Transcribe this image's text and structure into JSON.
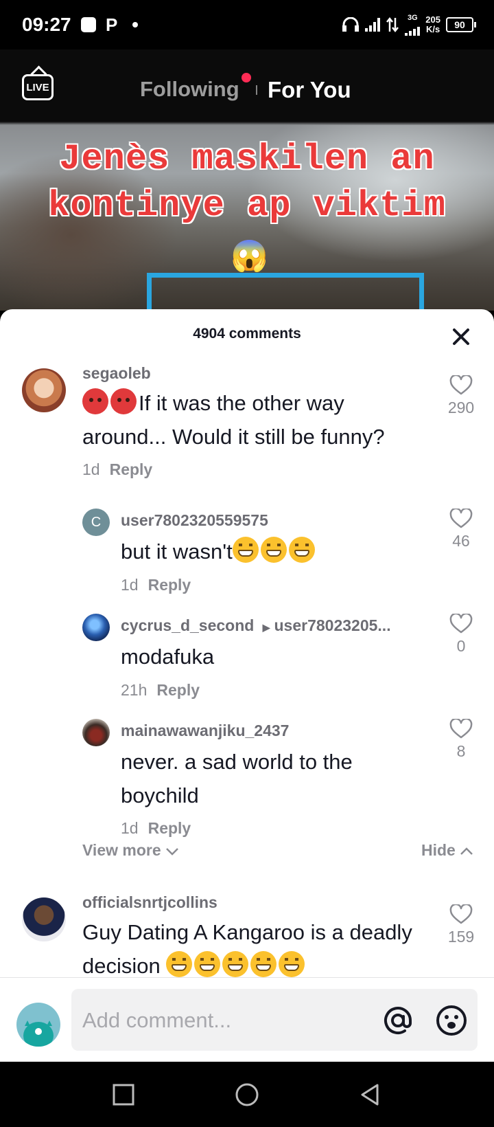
{
  "status_bar": {
    "time": "09:27",
    "left_icons": [
      "notification-square-icon",
      "p-app-icon",
      "dot-icon"
    ],
    "net_type": "3G",
    "net_speed_value": "205",
    "net_speed_unit": "K/s",
    "battery": "90"
  },
  "video": {
    "live_label": "LIVE",
    "tabs": {
      "following": "Following",
      "for_you": "For You"
    },
    "caption_line1": "Jenès maskilen an",
    "caption_line2": "kontinye ap viktim",
    "caption_emoji": "😱"
  },
  "comments_sheet": {
    "title": "4904 comments",
    "comments": [
      {
        "user": "segaoleb",
        "text": "If it was the other way around... Would it still be funny?",
        "emojis": [
          "angry",
          "angry"
        ],
        "time": "1d",
        "reply": "Reply",
        "likes": "290"
      },
      {
        "user": "user7802320559575",
        "avatar_letter": "C",
        "text": "but it wasn't",
        "emojis": [
          "grin",
          "grin",
          "grin"
        ],
        "time": "1d",
        "reply": "Reply",
        "likes": "46"
      },
      {
        "user": "cycrus_d_second",
        "reply_to": "user78023205...",
        "text": "modafuka",
        "time": "21h",
        "reply": "Reply",
        "likes": "0"
      },
      {
        "user": "mainawawanjiku_2437",
        "text": "never. a sad world to the boychild",
        "time": "1d",
        "reply": "Reply",
        "likes": "8"
      },
      {
        "user": "officialsnrtjcollins",
        "text": "Guy Dating A Kangaroo is a deadly decision",
        "emojis": [
          "grin",
          "grin",
          "grin",
          "grin",
          "grin"
        ],
        "likes": "159"
      }
    ],
    "view_more": "View more",
    "hide": "Hide"
  },
  "input_bar": {
    "placeholder": "Add comment..."
  },
  "colors": {
    "accent": "#fe2c55",
    "caption_red": "#ea3a3a",
    "frame_blue": "#2aa6e0",
    "text_primary": "#161823",
    "text_secondary": "#8a8b91"
  }
}
